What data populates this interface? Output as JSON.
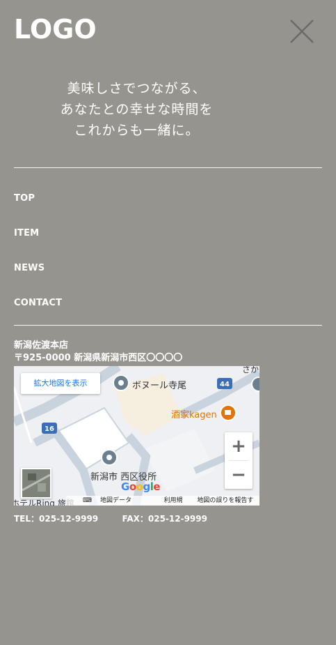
{
  "header": {
    "logo": "LOGO",
    "close_icon": "close-icon"
  },
  "tagline": [
    "美味しさでつながる、",
    "あなたとの幸せな時間を",
    "これからも一緒に。"
  ],
  "nav": [
    {
      "label": "TOP"
    },
    {
      "label": "ITEM"
    },
    {
      "label": "NEWS"
    },
    {
      "label": "CONTACT"
    }
  ],
  "shop": {
    "name": "新潟佐渡本店",
    "address": "〒925-0000 新潟県新潟市西区〇〇〇〇"
  },
  "map": {
    "expand_label": "拡大地図を表示",
    "places": {
      "bonoor": "ボヌール寺尾",
      "kagen": "酒家kagen",
      "ward_office": "新潟市 西区役所",
      "hotel": "ホテルRing 旅館",
      "top_right": "さか"
    },
    "road_badges": {
      "r44": "44",
      "r16": "16"
    },
    "zoom_in": "+",
    "zoom_out": "−",
    "google": "Google",
    "footer": {
      "map_data": "地図データ ©2025",
      "terms": "利用規約",
      "report": "地図の誤りを報告する"
    },
    "colors": {
      "pin": "#6b7f8e",
      "cafe": "#e37400",
      "road": "#c9d3de",
      "badge": "#3a6fb8"
    }
  },
  "contact": {
    "tel": "TEL：025-12-9999",
    "fax": "FAX：025-12-9999"
  },
  "colors": {
    "background": "#96948f",
    "text": "#ffffff"
  }
}
